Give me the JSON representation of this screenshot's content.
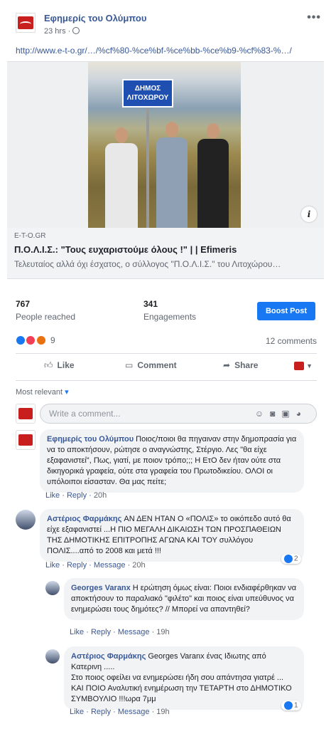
{
  "post": {
    "page_name": "Εφημερίς του Ολύμπου",
    "time": "23 hrs ·",
    "url": "http://www.e-t-o.gr/…/%cf%80-%ce%bf-%ce%bb-%ce%b9-%cf%83-%…/"
  },
  "link": {
    "sign_line1": "ΔΗΜΟΣ",
    "sign_line2": "ΛΙΤΟΧΩΡΟΥ",
    "domain": "E-T-O.GR",
    "title": "Π.Ο.Λ.Ι.Σ.: \"Τους ευχαριστούμε όλους !\" | | Efimeris",
    "description": "Τελευταίος αλλά όχι έσχατος, ο σύλλογος \"Π.Ο.Λ.Ι.Σ.\" του Λιτοχώρου…"
  },
  "stats": {
    "reached_value": "767",
    "reached_label": "People reached",
    "engagements_value": "341",
    "engagements_label": "Engagements",
    "boost_label": "Boost Post"
  },
  "reactions": {
    "count": "9",
    "comments": "12 comments"
  },
  "actions": {
    "like": "Like",
    "comment": "Comment",
    "share": "Share"
  },
  "sort_label": "Most relevant",
  "composer_placeholder": "Write a comment...",
  "comments": [
    {
      "author": "Εφημερίς του Ολύμπου",
      "text": "Ποιος/ποιοι θα πηγαιναν στην δημοπρασία για να το αποκτήσουν, ρώτησε ο αναγνώστης, Στέργιο. Λες \"θα είχε εξαφανιστεί\", Πως, γιατί, με ποιον τρόπο;;; Η ΕτΟ δεν ήταν ούτε στα δικηγορικά γραφεία, ούτε στα γραφεία του Πρωτοδικείου. ΟΛΟΙ οι υπόλοιποι είσασταν. Θα μας πείτε;",
      "like": "Like",
      "reply": "Reply",
      "time": "20h"
    },
    {
      "author": "Αστέριος Φαρμάκης",
      "text": "ΑΝ ΔΕΝ ΗΤΑΝ Ο «ΠΟΛΙΣ» το οικόπεδο αυτό θα είχε εξαφανιστεί ...Η ΠΙΟ ΜΕΓΑΛΗ ΔΙΚΑΙΩΣΗ ΤΩΝ ΠΡΟΣΠΑΘΕΙΩΝ ΤΗΣ ΔΗΜΟΤΙΚΗΣ ΕΠΙΤΡΟΠΗΣ ΑΓΩΝΑ ΚΑΙ ΤΟΥ συλλόγου ΠΟΛΙΣ....από το 2008 και μετά !!!",
      "like": "Like",
      "reply": "Reply",
      "message": "Message",
      "time": "20h",
      "likes": "2"
    },
    {
      "author": "Georges Varanx",
      "text": "Η ερώτηση όμως είναι: Ποιοι ενδιαφέρθηκαν να αποκτήσουν το παραλιακό \"φιλέτο\" και ποιος είναι υπεύθυνος να ενημερώσει τους δημότες? // Μπορεί να απαντηθεί?",
      "like": "Like",
      "reply": "Reply",
      "message": "Message",
      "time": "19h"
    },
    {
      "author": "Αστέριος Φαρμάκης",
      "text_line1": "Georges Varanx ένας Ιδιωτης από Κατερινη .....",
      "text_line2": "Στο ποιος οφείλει να ενημερώσει ήδη σου απάντησα γιατρέ ... ΚΑΙ ΠΟΙΟ Αναλυτική ενημέρωση την ΤΕΤΑΡΤΗ στο ΔΗΜΟΤΙΚΟ ΣΥΜΒΟΥΛΙΟ !!!ωρα 7μμ",
      "like": "Like",
      "reply": "Reply",
      "message": "Message",
      "time": "19h",
      "likes": "1"
    }
  ],
  "colors": {
    "link_blue": "#385898",
    "brand_blue": "#1877f2",
    "page_red": "#c81e1e"
  }
}
